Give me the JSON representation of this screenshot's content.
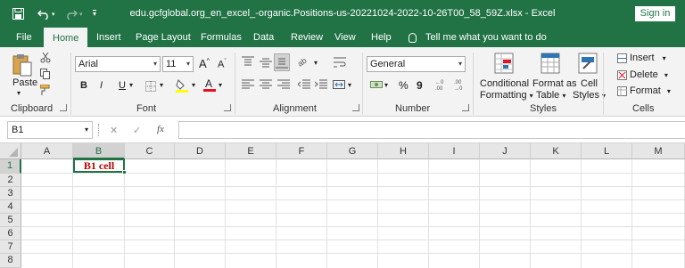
{
  "title_bar": {
    "document_title": "edu.gcfglobal.org_en_excel_-organic.Positions-us-20221024-2022-10-26T00_58_59Z.xlsx  -  Excel",
    "sign_in": "Sign in",
    "qat_icons": [
      "save-icon",
      "undo-icon",
      "redo-icon",
      "customize-qat-icon"
    ]
  },
  "tabs": [
    "File",
    "Home",
    "Insert",
    "Page Layout",
    "Formulas",
    "Data",
    "Review",
    "View",
    "Help"
  ],
  "active_tab": "Home",
  "tell_me": "Tell me what you want to do",
  "ribbon": {
    "clipboard": {
      "paste": "Paste",
      "label": "Clipboard"
    },
    "font": {
      "name": "Arial",
      "size": "11",
      "label": "Font",
      "bold": "B",
      "italic": "I",
      "underline": "U",
      "grow": "A",
      "shrink": "A",
      "font_color_swatch": "#e81123",
      "highlight_swatch": "#ffff00"
    },
    "alignment": {
      "label": "Alignment"
    },
    "number": {
      "format": "General",
      "label": "Number",
      "currency": "$",
      "percent": "%",
      "comma": "9"
    },
    "styles": {
      "conditional_1": "Conditional",
      "conditional_2": "Formatting",
      "format_table_1": "Format as",
      "format_table_2": "Table",
      "cell_styles_1": "Cell",
      "cell_styles_2": "Styles",
      "label": "Styles"
    },
    "cells": {
      "insert": "Insert",
      "delete": "Delete",
      "format": "Format",
      "label": "Cells"
    }
  },
  "formula_bar": {
    "name_box": "B1",
    "cancel": "✕",
    "enter": "✓",
    "fx": "fx",
    "content": ""
  },
  "sheet": {
    "columns": [
      "A",
      "B",
      "C",
      "D",
      "E",
      "F",
      "G",
      "H",
      "I",
      "J",
      "K",
      "L",
      "M"
    ],
    "rows": [
      "1",
      "2",
      "3",
      "4",
      "5",
      "6",
      "7",
      "8"
    ],
    "selected_column": "B",
    "selected_row": "1",
    "cell_b1": "B1 cell"
  },
  "colors": {
    "excel_green": "#217346",
    "cell_text": "#c00000"
  }
}
